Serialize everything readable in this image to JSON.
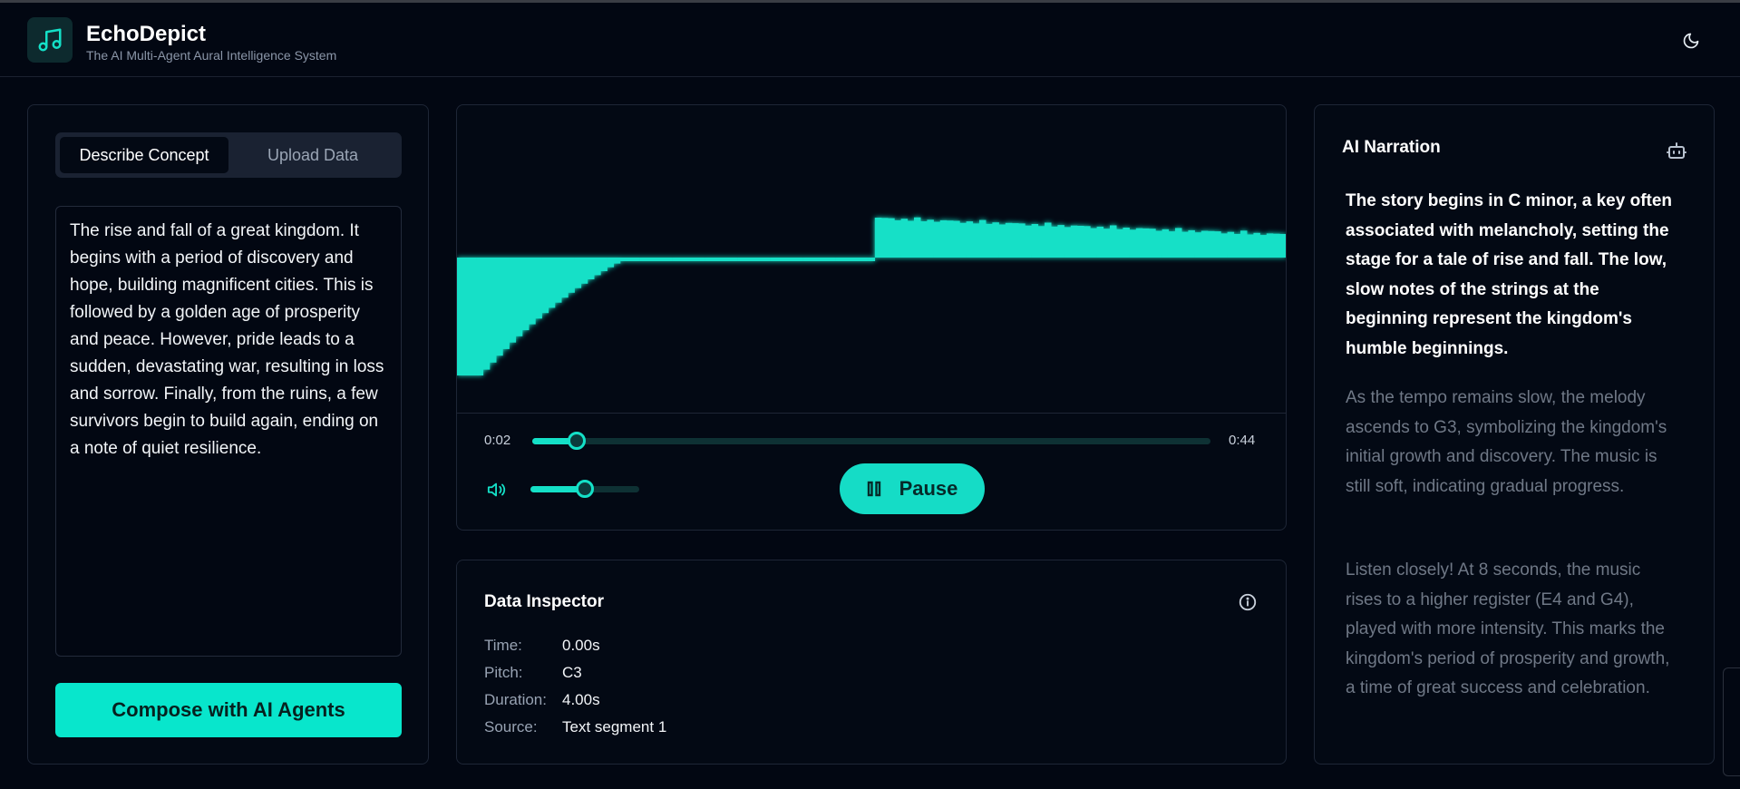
{
  "app": {
    "title": "EchoDepict",
    "subtitle": "The AI Multi-Agent Aural Intelligence System"
  },
  "icons": {
    "logo": "music-note-icon",
    "theme": "moon-icon",
    "volume": "volume-icon",
    "pause": "pause-icon",
    "info": "info-icon",
    "narration": "bot-icon"
  },
  "colors": {
    "accent": "#14e0c7",
    "background": "#020712"
  },
  "input": {
    "tabs": [
      {
        "label": "Describe Concept",
        "active": true
      },
      {
        "label": "Upload Data",
        "active": false
      }
    ],
    "concept_text": "The rise and fall of a great kingdom. It begins with a period of discovery and hope, building magnificent cities. This is followed by a golden age of prosperity and peace. However, pride leads to a sudden, devastating war, resulting in loss and sorrow. Finally, from the ruins, a few survivors begin to build again, ending on a note of quiet resilience.",
    "compose_label": "Compose with AI Agents"
  },
  "player": {
    "current_time": "0:02",
    "total_time": "0:44",
    "progress": 0.065,
    "volume": 0.5,
    "pause_label": "Pause"
  },
  "inspector": {
    "title": "Data Inspector",
    "rows": [
      {
        "label": "Time:",
        "value": "0.00s"
      },
      {
        "label": "Pitch:",
        "value": "C3"
      },
      {
        "label": "Duration:",
        "value": "4.00s"
      },
      {
        "label": "Source:",
        "value": "Text segment 1"
      }
    ]
  },
  "narration": {
    "title": "AI Narration",
    "paragraphs": [
      {
        "text": "The story begins in C minor, a key often associated with melancholy, setting the stage for a tale of rise and fall. The low, slow notes of the strings at the beginning represent the kingdom's humble beginnings.",
        "current": true
      },
      {
        "text": "As the tempo remains slow, the melody ascends to G3, symbolizing the kingdom's initial growth and discovery. The music is still soft, indicating gradual progress.",
        "current": false
      },
      {
        "text": "Listen closely! At 8 seconds, the music rises to a higher register (E4 and G4), played with more intensity. This marks the kingdom's period of prosperity and growth, a time of great success and celebration.",
        "current": false
      }
    ]
  }
}
